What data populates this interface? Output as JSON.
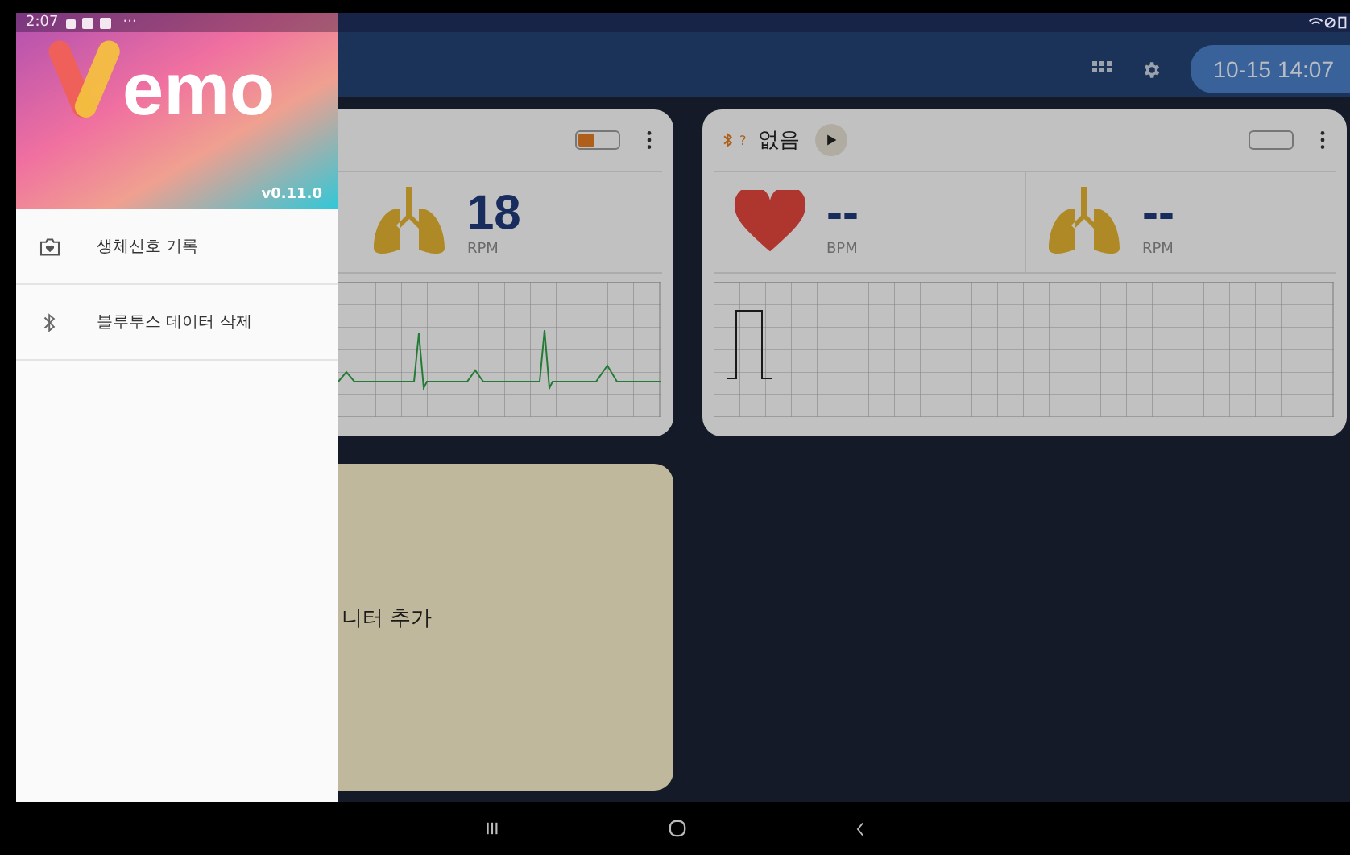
{
  "status_bar": {
    "time": "2:07",
    "more": "···"
  },
  "toolbar": {
    "datetime": "10-15 14:07"
  },
  "monitors": [
    {
      "battery": {
        "level": 0.4
      },
      "vitals": [
        {
          "kind": "resp",
          "value": "18",
          "unit": "RPM"
        }
      ],
      "kind": "ecg"
    },
    {
      "device": {
        "status": "?",
        "name": "없음"
      },
      "battery": {
        "level": 0
      },
      "vitals": [
        {
          "kind": "heart",
          "value": "--",
          "unit": "BPM"
        },
        {
          "kind": "resp",
          "value": "--",
          "unit": "RPM"
        }
      ],
      "kind": "square"
    }
  ],
  "add_card": {
    "label": "니터 추가"
  },
  "drawer": {
    "logo_text": "emo",
    "version": "v0.11.0",
    "items": [
      {
        "kind": "folder",
        "label": "생체신호 기록"
      },
      {
        "kind": "bluetooth",
        "label": "블루투스 데이터 삭제"
      }
    ]
  }
}
